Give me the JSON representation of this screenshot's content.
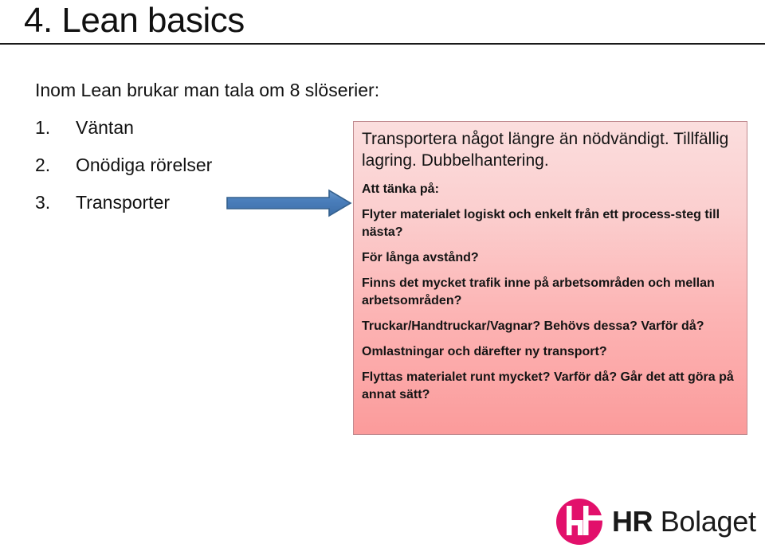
{
  "slide": {
    "title": "4. Lean basics",
    "intro": "Inom Lean brukar man tala om 8 slöserier:",
    "waste_list": [
      {
        "num": "1.",
        "label": "Väntan"
      },
      {
        "num": "2.",
        "label": "Onödiga rörelser"
      },
      {
        "num": "3.",
        "label": "Transporter"
      }
    ],
    "arrow": {
      "icon": "right-arrow-icon",
      "direction": "right",
      "fill": "#4a7ebb",
      "stroke": "#35618e"
    }
  },
  "callout": {
    "heading": "Transportera något längre än nödvändigt. Tillfällig lagring. Dubbelhantering.",
    "subheading": "Att tänka på:",
    "points": [
      "Flyter materialet logiskt och enkelt från ett process-steg till nästa?",
      "För långa avstånd?",
      "Finns det mycket trafik inne på arbetsområden och mellan arbetsområden?",
      "Truckar/Handtruckar/Vagnar? Behövs dessa? Varför då?",
      "Omlastningar och därefter ny transport?",
      "Flyttas materialet runt mycket? Varför då? Går det att göra på annat sätt?"
    ],
    "colors": {
      "gradient_top": "#fbdede",
      "gradient_bottom": "#fb9b9b",
      "border": "#c08a8f"
    }
  },
  "logo": {
    "mark_alt": "hr-bolaget-logo-icon",
    "name_bold": "HR",
    "name_light": " Bolaget",
    "brand_color": "#e2106b"
  }
}
